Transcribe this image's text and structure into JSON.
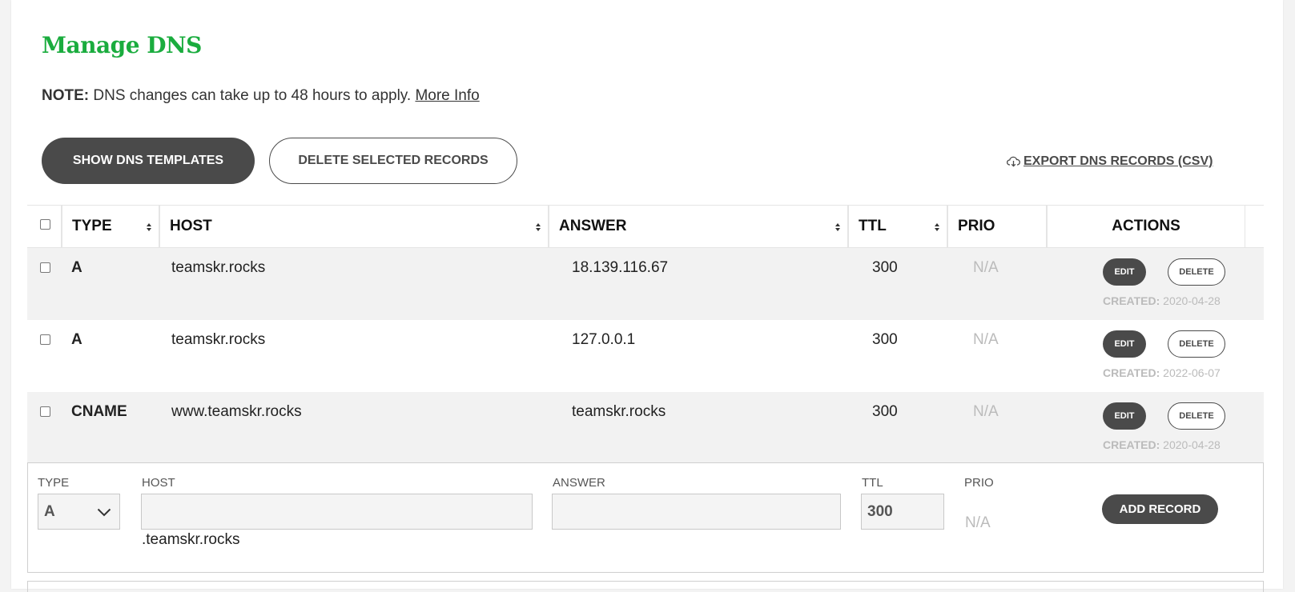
{
  "page": {
    "title": "Manage DNS",
    "note_label": "NOTE:",
    "note_text": " DNS changes can take up to 48 hours to apply. ",
    "note_link": "More Info"
  },
  "toolbar": {
    "show_templates": "SHOW DNS TEMPLATES",
    "delete_selected": "DELETE SELECTED RECORDS",
    "export": " EXPORT DNS RECORDS (CSV)"
  },
  "table": {
    "columns": {
      "type": "TYPE",
      "host": "HOST",
      "answer": "ANSWER",
      "ttl": "TTL",
      "prio": "PRIO",
      "actions": "ACTIONS"
    },
    "rows": [
      {
        "type": "A",
        "host": "teamskr.rocks",
        "answer": "18.139.116.67",
        "ttl": "300",
        "prio": "N/A",
        "edit": "EDIT",
        "delete": "DELETE",
        "created_label": "CREATED:",
        "created": " 2020-04-28"
      },
      {
        "type": "A",
        "host": "teamskr.rocks",
        "answer": "127.0.0.1",
        "ttl": "300",
        "prio": "N/A",
        "edit": "EDIT",
        "delete": "DELETE",
        "created_label": "CREATED:",
        "created": " 2022-06-07"
      },
      {
        "type": "CNAME",
        "host": "www.teamskr.rocks",
        "answer": "teamskr.rocks",
        "ttl": "300",
        "prio": "N/A",
        "edit": "EDIT",
        "delete": "DELETE",
        "created_label": "CREATED:",
        "created": " 2020-04-28"
      }
    ]
  },
  "add_record": {
    "type_label": "TYPE",
    "type_value": "A",
    "host_label": "HOST",
    "host_value": "",
    "host_suffix": ".teamskr.rocks",
    "answer_label": "ANSWER",
    "answer_value": "",
    "ttl_label": "TTL",
    "ttl_value": "300",
    "prio_label": "PRIO",
    "prio_value": "N/A",
    "button": "ADD RECORD"
  },
  "icons": {
    "export": "cloud-download-icon",
    "sort": "sort-icon",
    "select_chevron": "chevron-down-icon"
  },
  "colors": {
    "title": "#1aac3e",
    "dark_button": "#4a4a4a",
    "row_shade": "#f2f2f2",
    "muted": "#bbbbbb"
  }
}
